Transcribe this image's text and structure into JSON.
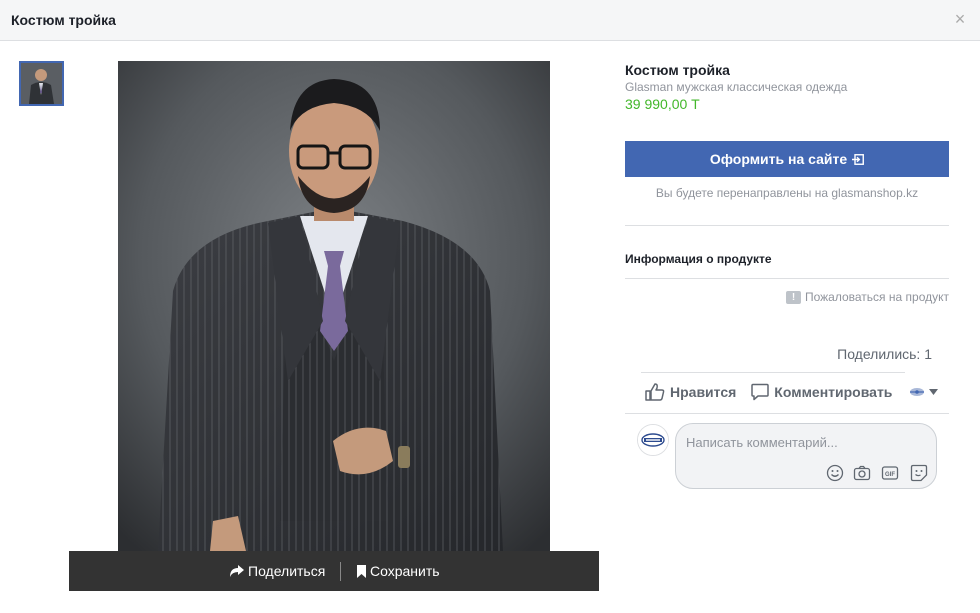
{
  "header": {
    "title": "Костюм тройка"
  },
  "product": {
    "title": "Костюм тройка",
    "seller": "Glasman мужская классическая одежда",
    "price": "39 990,00 Т"
  },
  "cta": {
    "label": "Оформить на сайте",
    "redirect_text": "Вы будете перенаправлены на glasmanshop.kz"
  },
  "info": {
    "title": "Информация о продукте",
    "report": "Пожаловаться на продукт"
  },
  "photo_bar": {
    "share": "Поделиться",
    "save": "Сохранить"
  },
  "social": {
    "shares": "Поделились: 1",
    "like": "Нравится",
    "comment": "Комментировать"
  },
  "comment": {
    "placeholder": "Написать комментарий..."
  },
  "colors": {
    "brand": "#4267b2",
    "price": "#42b72a",
    "muted": "#90949c"
  },
  "icons": [
    "close-icon",
    "share-icon",
    "bookmark-icon",
    "external-link-icon",
    "report-icon",
    "like-icon",
    "comment-icon",
    "audience-icon",
    "chevron-down-icon",
    "emoji-icon",
    "camera-icon",
    "gif-icon",
    "sticker-icon"
  ]
}
